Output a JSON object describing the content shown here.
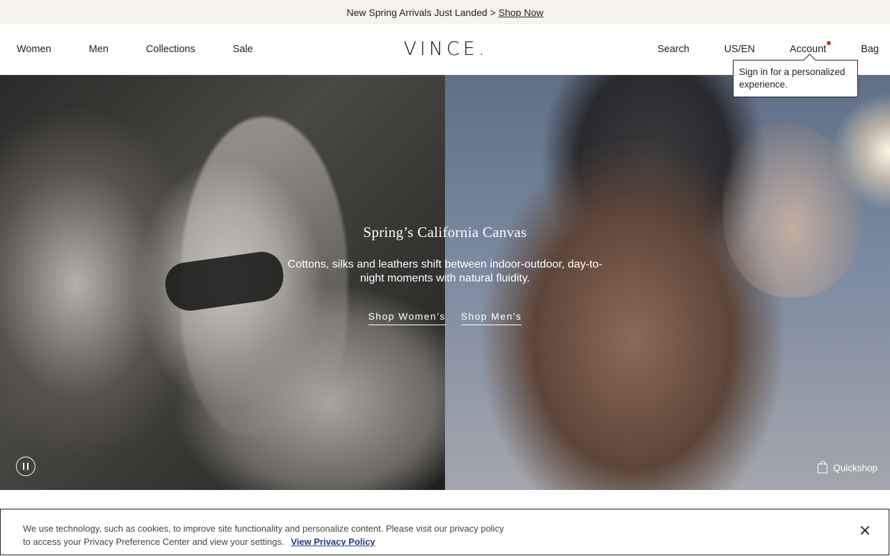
{
  "promo": {
    "text": "New Spring Arrivals Just Landed >",
    "link": "Shop Now"
  },
  "header": {
    "nav_left": [
      "Women",
      "Men",
      "Collections",
      "Sale"
    ],
    "logo": "VINCE.",
    "nav_right": {
      "search": "Search",
      "locale": "US/EN",
      "account": "Account",
      "bag": "Bag"
    }
  },
  "tooltip": {
    "text": "Sign in for a personalized experience."
  },
  "hero": {
    "title": "Spring’s California Canvas",
    "subtitle": "Cottons, silks and leathers shift between indoor-outdoor, day-to-night moments with natural fluidity.",
    "cta_women": "Shop Women’s",
    "cta_men": "Shop Men’s",
    "quickshop": "Quickshop"
  },
  "cookie": {
    "text": "We use technology, such as cookies, to improve site functionality and personalize content. Please visit our privacy policy to access your Privacy Preference Center and view your settings.",
    "link": "View Privacy Policy",
    "close": "×"
  },
  "colors": {
    "promo_bg": "#f6f3ee",
    "notification_dot": "#c0392b",
    "policy_link": "#1f3b8a"
  },
  "icons": {
    "pause": "pause-icon",
    "bag": "bag-icon",
    "close": "close-icon"
  }
}
